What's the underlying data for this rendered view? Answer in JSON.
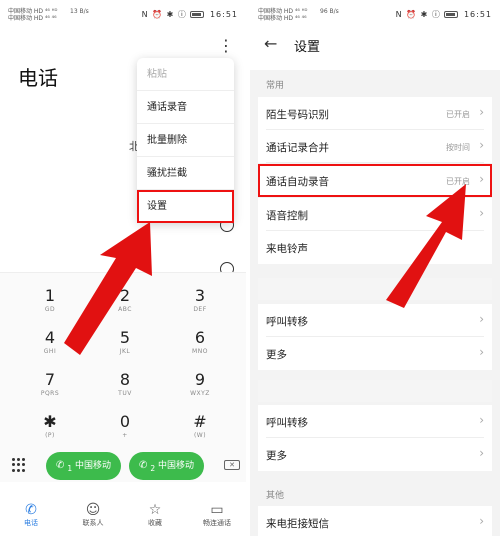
{
  "status_bar": {
    "left_line1": "中国移动 HD ⁴⁶ ᴴᴰ",
    "left_line2": "中国移动 HD ⁴⁶ ⁴⁶",
    "speed_left": "13 B/s",
    "speed_right": "96 B/s",
    "time": "16:51",
    "icons": "N ⏰ ✱ ⓘ"
  },
  "left": {
    "title": "电话",
    "ghost_text": "北",
    "menu": [
      "粘贴",
      "通话录音",
      "批量删除",
      "骚扰拦截",
      "设置"
    ],
    "menu_highlight_index": 4,
    "keys": [
      {
        "d": "1",
        "l": "GD"
      },
      {
        "d": "2",
        "l": "ABC"
      },
      {
        "d": "3",
        "l": "DEF"
      },
      {
        "d": "4",
        "l": "GHI"
      },
      {
        "d": "5",
        "l": "JKL"
      },
      {
        "d": "6",
        "l": "MNO"
      },
      {
        "d": "7",
        "l": "PQRS"
      },
      {
        "d": "8",
        "l": "TUV"
      },
      {
        "d": "9",
        "l": "WXYZ"
      },
      {
        "d": "✱",
        "l": "(P)"
      },
      {
        "d": "0",
        "l": "+"
      },
      {
        "d": "#",
        "l": "(W)"
      }
    ],
    "call_buttons": [
      "中国移动",
      "中国移动"
    ],
    "call_sim": [
      "1",
      "2"
    ],
    "tabs": [
      "电话",
      "联系人",
      "收藏",
      "畅连通话"
    ],
    "active_tab_index": 0
  },
  "right": {
    "title": "设置",
    "sections": [
      {
        "label": "常用",
        "rows": [
          {
            "title": "陌生号码识别",
            "value": "已开启"
          },
          {
            "title": "通话记录合并",
            "value": "按时间"
          },
          {
            "title": "通话自动录音",
            "value": "已开启"
          },
          {
            "title": "语音控制",
            "value": ""
          },
          {
            "title": "来电铃声",
            "value": ""
          }
        ]
      },
      {
        "label": "",
        "rows": [
          {
            "title": "呼叫转移",
            "value": ""
          },
          {
            "title": "更多",
            "value": ""
          }
        ]
      },
      {
        "label": "",
        "rows": [
          {
            "title": "呼叫转移",
            "value": ""
          },
          {
            "title": "更多",
            "value": ""
          }
        ]
      },
      {
        "label": "其他",
        "rows": [
          {
            "title": "来电拒接短信",
            "value": ""
          }
        ]
      }
    ],
    "highlight_row": "通话自动录音"
  },
  "colors": {
    "accent": "#2a7de1",
    "call_green": "#3dbb4c",
    "annotation_red": "#e11111"
  }
}
